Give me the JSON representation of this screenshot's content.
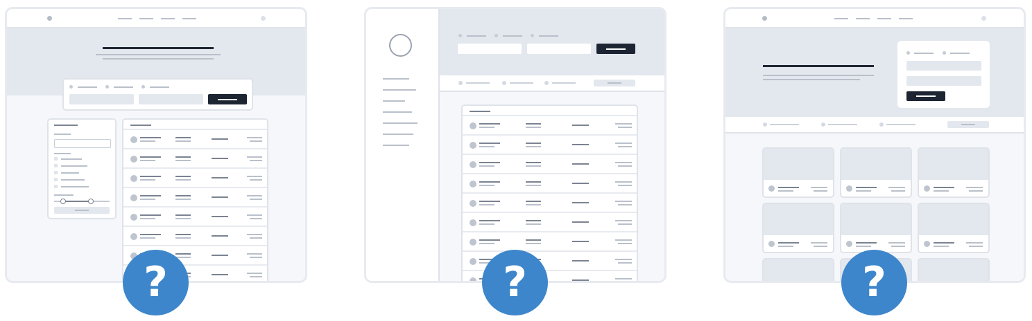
{
  "wireframes": [
    {
      "layout": "search-hero-with-filter-sidebar-and-table"
    },
    {
      "layout": "left-sidebar-with-top-search-and-table"
    },
    {
      "layout": "split-hero-with-search-card-and-card-grid"
    }
  ],
  "help_badge": {
    "glyph": "?",
    "icon": "question-mark-icon",
    "color": "#3d86cb"
  },
  "colors": {
    "frame_border": "#e7eaef",
    "hero": "#e3e7ee",
    "dark_button": "#1d2533",
    "lines": "#b9c0ca"
  }
}
